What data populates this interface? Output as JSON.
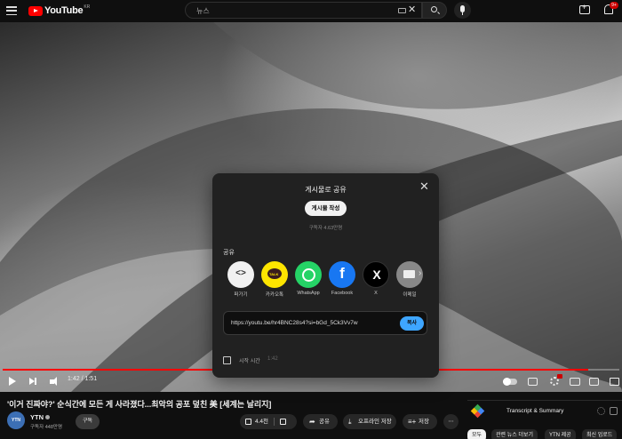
{
  "header": {
    "logo_text": "YouTube",
    "region": "KR",
    "search_value": "뉴스",
    "notification_count": "9+"
  },
  "player": {
    "progress_fraction": 0.95,
    "time": "1:42 / 1:51"
  },
  "share_dialog": {
    "title": "게시물로 공유",
    "post_button": "게시물 작성",
    "subscriber_note": "구독자 4.63만명",
    "share_label": "공유",
    "targets": [
      {
        "name": "퍼가기",
        "icon": "embed-icon"
      },
      {
        "name": "카카오톡",
        "icon": "kakaotalk-icon",
        "badge": "TALK"
      },
      {
        "name": "WhatsApp",
        "icon": "whatsapp-icon"
      },
      {
        "name": "Facebook",
        "icon": "facebook-icon"
      },
      {
        "name": "X",
        "icon": "x-icon"
      },
      {
        "name": "이메일",
        "icon": "email-icon"
      }
    ],
    "url": "https://youtu.be/hr4BNC28s4?si=bGd_5Ck3Vv7w",
    "copy_button": "복사",
    "start_at_label": "시작 시간",
    "start_at_time": "1:42"
  },
  "video": {
    "title": "'이거 진짜야?' 순식간에 모든 게 사라졌다...최악의 공포 덮친 美 [세계는 날리지]",
    "channel": "YTN",
    "avatar_text": "YTN",
    "subscribers": "구독자 448만명",
    "subscribe_label": "구독",
    "like_count": "4.4천",
    "share_label": "공유",
    "download_label": "오프라인 저장",
    "save_label": "저장",
    "more_label": "⋯"
  },
  "sidebar": {
    "transcript_title": "Transcript & Summary",
    "chips": [
      "모두",
      "관련 뉴스 더보기",
      "YTN 제공",
      "최신 업로드"
    ]
  },
  "colors": {
    "accent_red": "#ff0000",
    "copy_blue": "#3ea6ff",
    "kakao_yellow": "#fee500",
    "whatsapp_green": "#25d366",
    "facebook_blue": "#1877f2"
  }
}
